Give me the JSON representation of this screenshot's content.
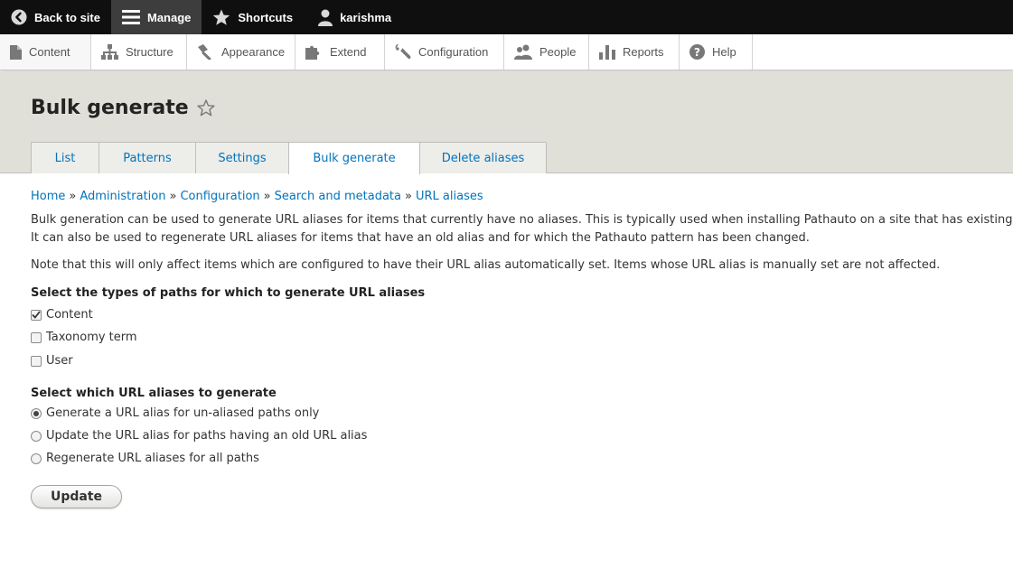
{
  "toolbar": {
    "back_label": "Back to site",
    "manage_label": "Manage",
    "shortcuts_label": "Shortcuts",
    "user_label": "karishma"
  },
  "tray": {
    "items": [
      {
        "label": "Content",
        "icon": "file-icon"
      },
      {
        "label": "Structure",
        "icon": "sitemap-icon"
      },
      {
        "label": "Appearance",
        "icon": "brush-icon"
      },
      {
        "label": "Extend",
        "icon": "puzzle-icon"
      },
      {
        "label": "Configuration",
        "icon": "wrench-icon"
      },
      {
        "label": "People",
        "icon": "people-icon"
      },
      {
        "label": "Reports",
        "icon": "bar-chart-icon"
      },
      {
        "label": "Help",
        "icon": "help-icon"
      }
    ]
  },
  "page": {
    "title": "Bulk generate",
    "tabs": [
      "List",
      "Patterns",
      "Settings",
      "Bulk generate",
      "Delete aliases"
    ],
    "active_tab": "Bulk generate"
  },
  "breadcrumb": [
    "Home",
    "Administration",
    "Configuration",
    "Search and metadata",
    "URL aliases"
  ],
  "breadcrumb_sep": "»",
  "intro": {
    "line1": "Bulk generation can be used to generate URL aliases for items that currently have no aliases. This is typically used when installing Pathauto on a site that has existing",
    "line2": "It can also be used to regenerate URL aliases for items that have an old alias and for which the Pathauto pattern has been changed.",
    "note": "Note that this will only affect items which are configured to have their URL alias automatically set. Items whose URL alias is manually set are not affected."
  },
  "types": {
    "label": "Select the types of paths for which to generate URL aliases",
    "options": [
      {
        "label": "Content",
        "checked": true
      },
      {
        "label": "Taxonomy term",
        "checked": false
      },
      {
        "label": "User",
        "checked": false
      }
    ]
  },
  "which": {
    "label": "Select which URL aliases to generate",
    "options": [
      {
        "label": "Generate a URL alias for un-aliased paths only",
        "selected": true
      },
      {
        "label": "Update the URL alias for paths having an old URL alias",
        "selected": false
      },
      {
        "label": "Regenerate URL aliases for all paths",
        "selected": false
      }
    ]
  },
  "submit_label": "Update",
  "colors": {
    "toolbar_bg": "#0f0f0f",
    "header_bg": "#e0e0d8",
    "link": "#0074bd"
  }
}
